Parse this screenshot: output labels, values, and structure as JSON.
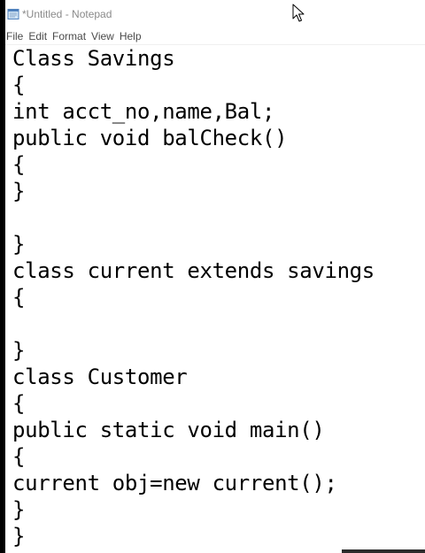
{
  "window": {
    "title": "*Untitled - Notepad"
  },
  "menu": {
    "items": [
      {
        "label": "File"
      },
      {
        "label": "Edit"
      },
      {
        "label": "Format"
      },
      {
        "label": "View"
      },
      {
        "label": "Help"
      }
    ]
  },
  "editor": {
    "lines": [
      "Class Savings",
      "{",
      "int acct_no,name,Bal;",
      "public void balCheck()",
      "{",
      "}",
      "",
      "}",
      "class current extends savings",
      "{",
      "",
      "}",
      "class Customer",
      "{",
      "public static void main()",
      "{",
      "current obj=new current();",
      "}",
      "}"
    ]
  },
  "icons": {
    "app": "notepad-icon",
    "pointer": "mouse-pointer-icon"
  },
  "colors": {
    "background": "#000000",
    "window": "#ffffff",
    "title_text": "#8a8a8a",
    "menu_text": "#4a4a4a",
    "code_text": "#000000"
  }
}
